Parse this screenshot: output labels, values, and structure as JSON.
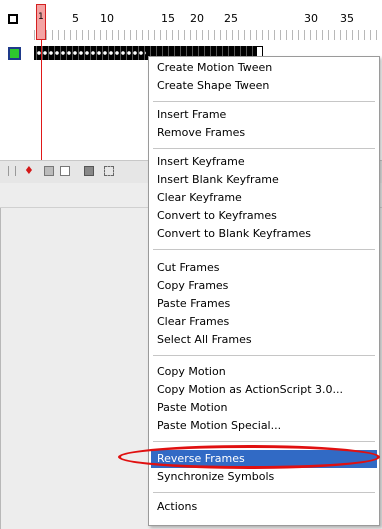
{
  "colors": {
    "playhead": "#e01818",
    "layer_color": "#2ec82e",
    "menu_highlight": "#316ac5",
    "annotation": "#e01010"
  },
  "timeline": {
    "ruler_labels": [
      "1",
      "5",
      "10",
      "15",
      "20",
      "25",
      "30",
      "35"
    ],
    "current_frame": "1",
    "outline_icon": "outline-square-icon",
    "layer_color_icon": "layer-color-swatch-icon",
    "toolbar_icons": [
      "grip-icon",
      "center-frame-icon",
      "onion-skin-icon",
      "onion-skin-outlines-icon",
      "edit-multiple-frames-icon",
      "onion-markers-icon"
    ]
  },
  "menu": {
    "items": [
      "Create Motion Tween",
      "Create Shape Tween",
      "Insert Frame",
      "Remove Frames",
      "Insert Keyframe",
      "Insert Blank Keyframe",
      "Clear Keyframe",
      "Convert to Keyframes",
      "Convert to Blank Keyframes",
      "Cut Frames",
      "Copy Frames",
      "Paste Frames",
      "Clear Frames",
      "Select All Frames",
      "Copy Motion",
      "Copy Motion as ActionScript 3.0...",
      "Paste Motion",
      "Paste Motion Special...",
      "Reverse Frames",
      "Synchronize Symbols",
      "Actions"
    ],
    "highlighted_item": "Reverse Frames"
  }
}
